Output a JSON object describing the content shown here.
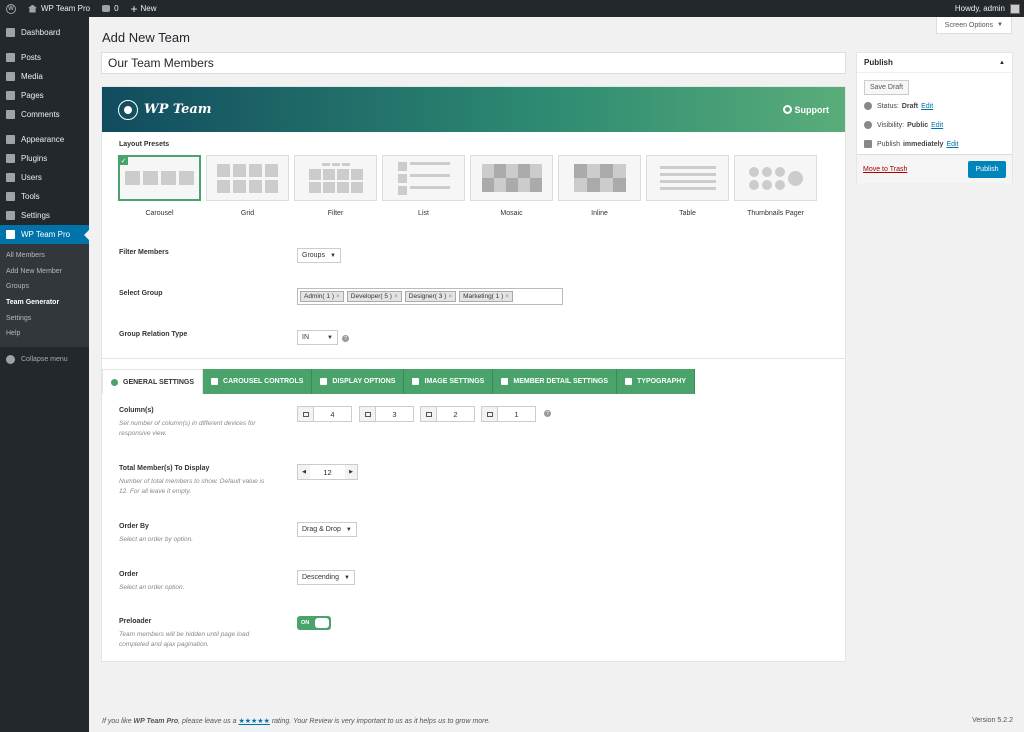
{
  "adminbar": {
    "site_name": "WP Team Pro",
    "comments_count": "0",
    "new_label": "New",
    "howdy": "Howdy, admin"
  },
  "sidebar": {
    "items": [
      {
        "label": "Dashboard",
        "icon": "dashboard-icon"
      },
      {
        "label": "Posts",
        "icon": "pin-icon"
      },
      {
        "label": "Media",
        "icon": "media-icon"
      },
      {
        "label": "Pages",
        "icon": "page-icon"
      },
      {
        "label": "Comments",
        "icon": "comment-icon"
      },
      {
        "label": "Appearance",
        "icon": "brush-icon"
      },
      {
        "label": "Plugins",
        "icon": "plugin-icon"
      },
      {
        "label": "Users",
        "icon": "users-icon"
      },
      {
        "label": "Tools",
        "icon": "wrench-icon"
      },
      {
        "label": "Settings",
        "icon": "settings-icon"
      },
      {
        "label": "WP Team Pro",
        "icon": "team-icon"
      }
    ],
    "submenu": [
      "All Members",
      "Add New Member",
      "Groups",
      "Team Generator",
      "Settings",
      "Help"
    ],
    "current_sub": "Team Generator",
    "collapse": "Collapse menu"
  },
  "screen_options": "Screen Options",
  "page_title": "Add New Team",
  "title_value": "Our Team Members",
  "banner": {
    "brand": "WP Team",
    "support": "Support"
  },
  "layout": {
    "label": "Layout Presets",
    "presets": [
      "Carousel",
      "Grid",
      "Filter",
      "List",
      "Mosaic",
      "Inline",
      "Table",
      "Thumbnails Pager"
    ],
    "selected": "Carousel"
  },
  "filter_members": {
    "label": "Filter Members",
    "value": "Groups"
  },
  "select_group": {
    "label": "Select Group",
    "tags": [
      "Admin( 1 )",
      "Developer( 5 )",
      "Designer( 3 )",
      "Marketing( 1 )"
    ]
  },
  "relation": {
    "label": "Group Relation Type",
    "value": "IN"
  },
  "tabs": [
    "GENERAL SETTINGS",
    "CAROUSEL CONTROLS",
    "DISPLAY OPTIONS",
    "IMAGE SETTINGS",
    "MEMBER DETAIL SETTINGS",
    "TYPOGRAPHY"
  ],
  "general": {
    "columns": {
      "label": "Column(s)",
      "desc": "Set number of column(s) in different devices for responsive view.",
      "values": [
        "4",
        "3",
        "2",
        "1"
      ]
    },
    "total": {
      "label": "Total Member(s) To Display",
      "desc": "Number of total members to show. Default value is 12. For all leave it empty.",
      "value": "12"
    },
    "order_by": {
      "label": "Order By",
      "desc": "Select an order by option.",
      "value": "Drag & Drop"
    },
    "order": {
      "label": "Order",
      "desc": "Select an order option.",
      "value": "Descending"
    },
    "preloader": {
      "label": "Preloader",
      "desc": "Team members will be hidden until page load completed and ajax pagination.",
      "toggle": "ON"
    }
  },
  "publish": {
    "title": "Publish",
    "save_draft": "Save Draft",
    "status_label": "Status:",
    "status_value": "Draft",
    "visibility_label": "Visibility:",
    "visibility_value": "Public",
    "publish_label": "Publish",
    "publish_value": "immediately",
    "edit": "Edit",
    "trash": "Move to Trash",
    "publish_button": "Publish"
  },
  "footer": {
    "text_before": "If you like",
    "plugin": "WP Team Pro",
    "text_mid": ", please leave us a",
    "stars": "★★★★★",
    "text_after": "rating. Your Review is very important to us as it helps us to grow more.",
    "version": "Version 5.2.2"
  },
  "colors": {
    "admin_blue": "#0073aa",
    "team_green": "#4aa36a",
    "banner_dark": "#114b5f"
  }
}
